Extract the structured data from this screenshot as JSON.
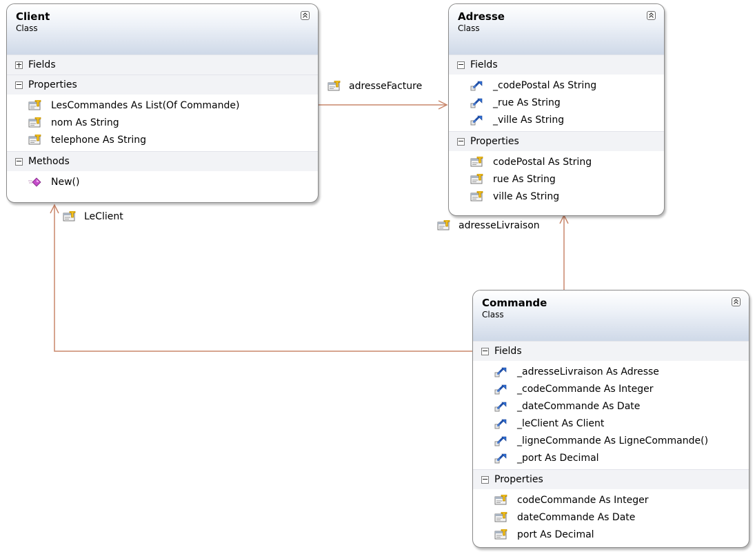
{
  "classes": {
    "client": {
      "name": "Client",
      "stereotype": "Class",
      "sections": {
        "fields": {
          "label": "Fields",
          "state": "collapsed"
        },
        "properties": {
          "label": "Properties",
          "state": "expanded",
          "members": [
            "LesCommandes As List(Of Commande)",
            "nom As String",
            "telephone As String"
          ]
        },
        "methods": {
          "label": "Methods",
          "state": "expanded",
          "members": [
            "New()"
          ]
        }
      }
    },
    "adresse": {
      "name": "Adresse",
      "stereotype": "Class",
      "sections": {
        "fields": {
          "label": "Fields",
          "state": "expanded",
          "members": [
            "_codePostal As String",
            "_rue As String",
            "_ville As String"
          ]
        },
        "properties": {
          "label": "Properties",
          "state": "expanded",
          "members": [
            "codePostal As String",
            "rue As String",
            "ville As String"
          ]
        }
      }
    },
    "commande": {
      "name": "Commande",
      "stereotype": "Class",
      "sections": {
        "fields": {
          "label": "Fields",
          "state": "expanded",
          "members": [
            "_adresseLivraison As Adresse",
            "_codeCommande As Integer",
            "_dateCommande As Date",
            "_leClient As Client",
            "_ligneCommande As LigneCommande()",
            "_port As Decimal"
          ]
        },
        "properties": {
          "label": "Properties",
          "state": "expanded",
          "members": [
            "codeCommande As Integer",
            "dateCommande As Date",
            "port As Decimal"
          ]
        }
      }
    }
  },
  "associations": {
    "adresse_facture": "adresseFacture",
    "le_client": "LeClient",
    "adresse_livraison": "adresseLivraison"
  },
  "icons": {
    "property": "property-icon",
    "field": "field-icon",
    "method": "method-icon",
    "collapse": "collapse-chevron-icon"
  },
  "colors": {
    "connector": "#c8866a",
    "box_border": "#8a8a8a",
    "header_bottom": "#cfd9e8",
    "section_bg": "#f2f3f6"
  }
}
